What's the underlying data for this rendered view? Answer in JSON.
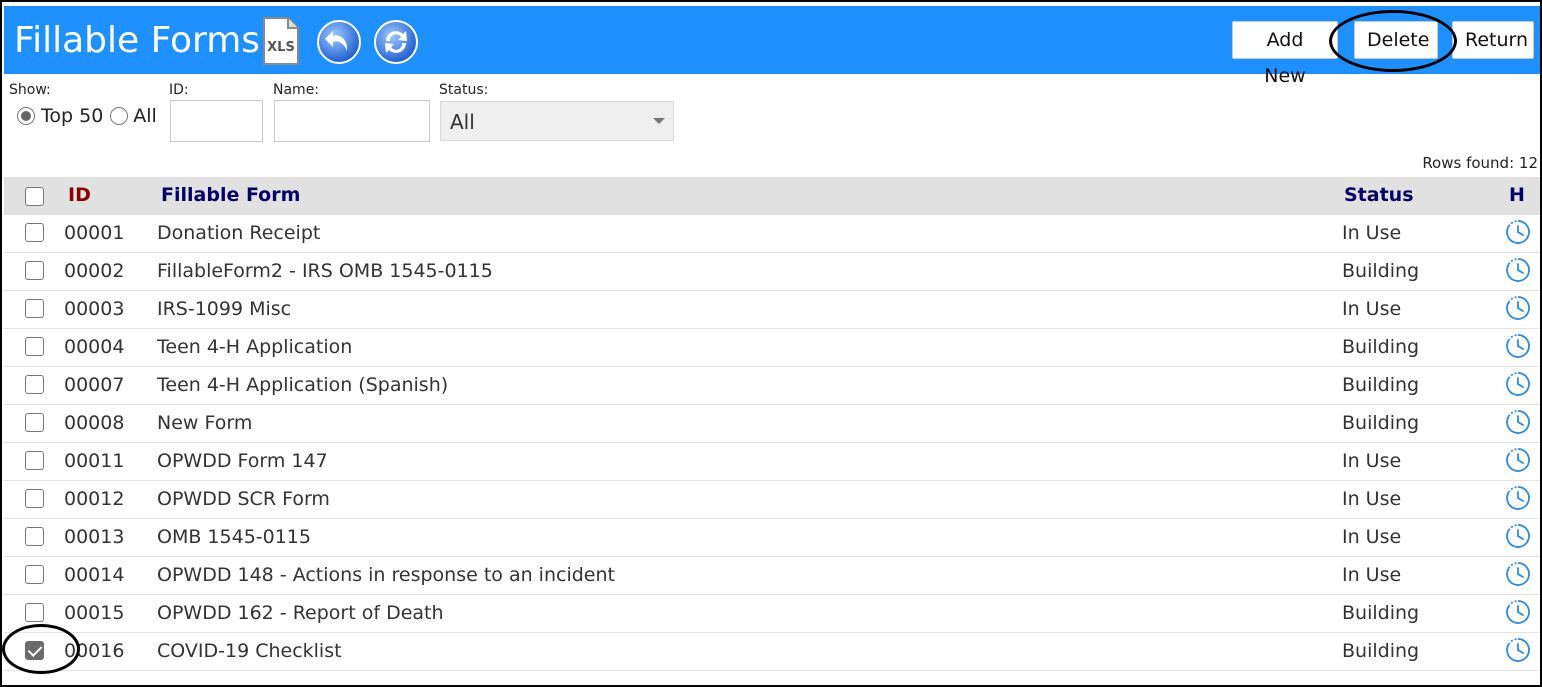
{
  "header": {
    "title": "Fillable Forms",
    "xls_icon": "xls-export-icon",
    "undo_icon": "undo-arrow-icon",
    "refresh_icon": "refresh-icon",
    "xls_label": "XLS",
    "buttons": {
      "add_new": "Add New",
      "delete": "Delete",
      "return": "Return"
    },
    "accent_color": "#1e90ff"
  },
  "filters": {
    "show_label": "Show:",
    "show_options": [
      "Top 50",
      "All"
    ],
    "show_selected": "Top 50",
    "id_label": "ID:",
    "id_value": "",
    "name_label": "Name:",
    "name_value": "",
    "status_label": "Status:",
    "status_value": "All"
  },
  "rows_found": "Rows found: 12",
  "table": {
    "columns": {
      "id": "ID",
      "form": "Fillable Form",
      "status": "Status",
      "history": "H"
    },
    "id_header_color": "#8b0000",
    "header_color": "#000066",
    "rows": [
      {
        "id": "00001",
        "name": "Donation Receipt",
        "status": "In Use",
        "checked": false
      },
      {
        "id": "00002",
        "name": "FillableForm2 - IRS OMB 1545-0115",
        "status": "Building",
        "checked": false
      },
      {
        "id": "00003",
        "name": "IRS-1099 Misc",
        "status": "In Use",
        "checked": false
      },
      {
        "id": "00004",
        "name": "Teen 4-H Application",
        "status": "Building",
        "checked": false
      },
      {
        "id": "00007",
        "name": "Teen 4-H Application (Spanish)",
        "status": "Building",
        "checked": false
      },
      {
        "id": "00008",
        "name": "New Form",
        "status": "Building",
        "checked": false
      },
      {
        "id": "00011",
        "name": "OPWDD Form 147",
        "status": "In Use",
        "checked": false
      },
      {
        "id": "00012",
        "name": "OPWDD SCR Form",
        "status": "In Use",
        "checked": false
      },
      {
        "id": "00013",
        "name": "OMB 1545-0115",
        "status": "In Use",
        "checked": false
      },
      {
        "id": "00014",
        "name": "OPWDD 148 - Actions in response to an incident",
        "status": "In Use",
        "checked": false
      },
      {
        "id": "00015",
        "name": "OPWDD 162 - Report of Death",
        "status": "Building",
        "checked": false
      },
      {
        "id": "00016",
        "name": "COVID-19 Checklist",
        "status": "Building",
        "checked": true
      }
    ],
    "history_icon": "history-clock-icon"
  }
}
